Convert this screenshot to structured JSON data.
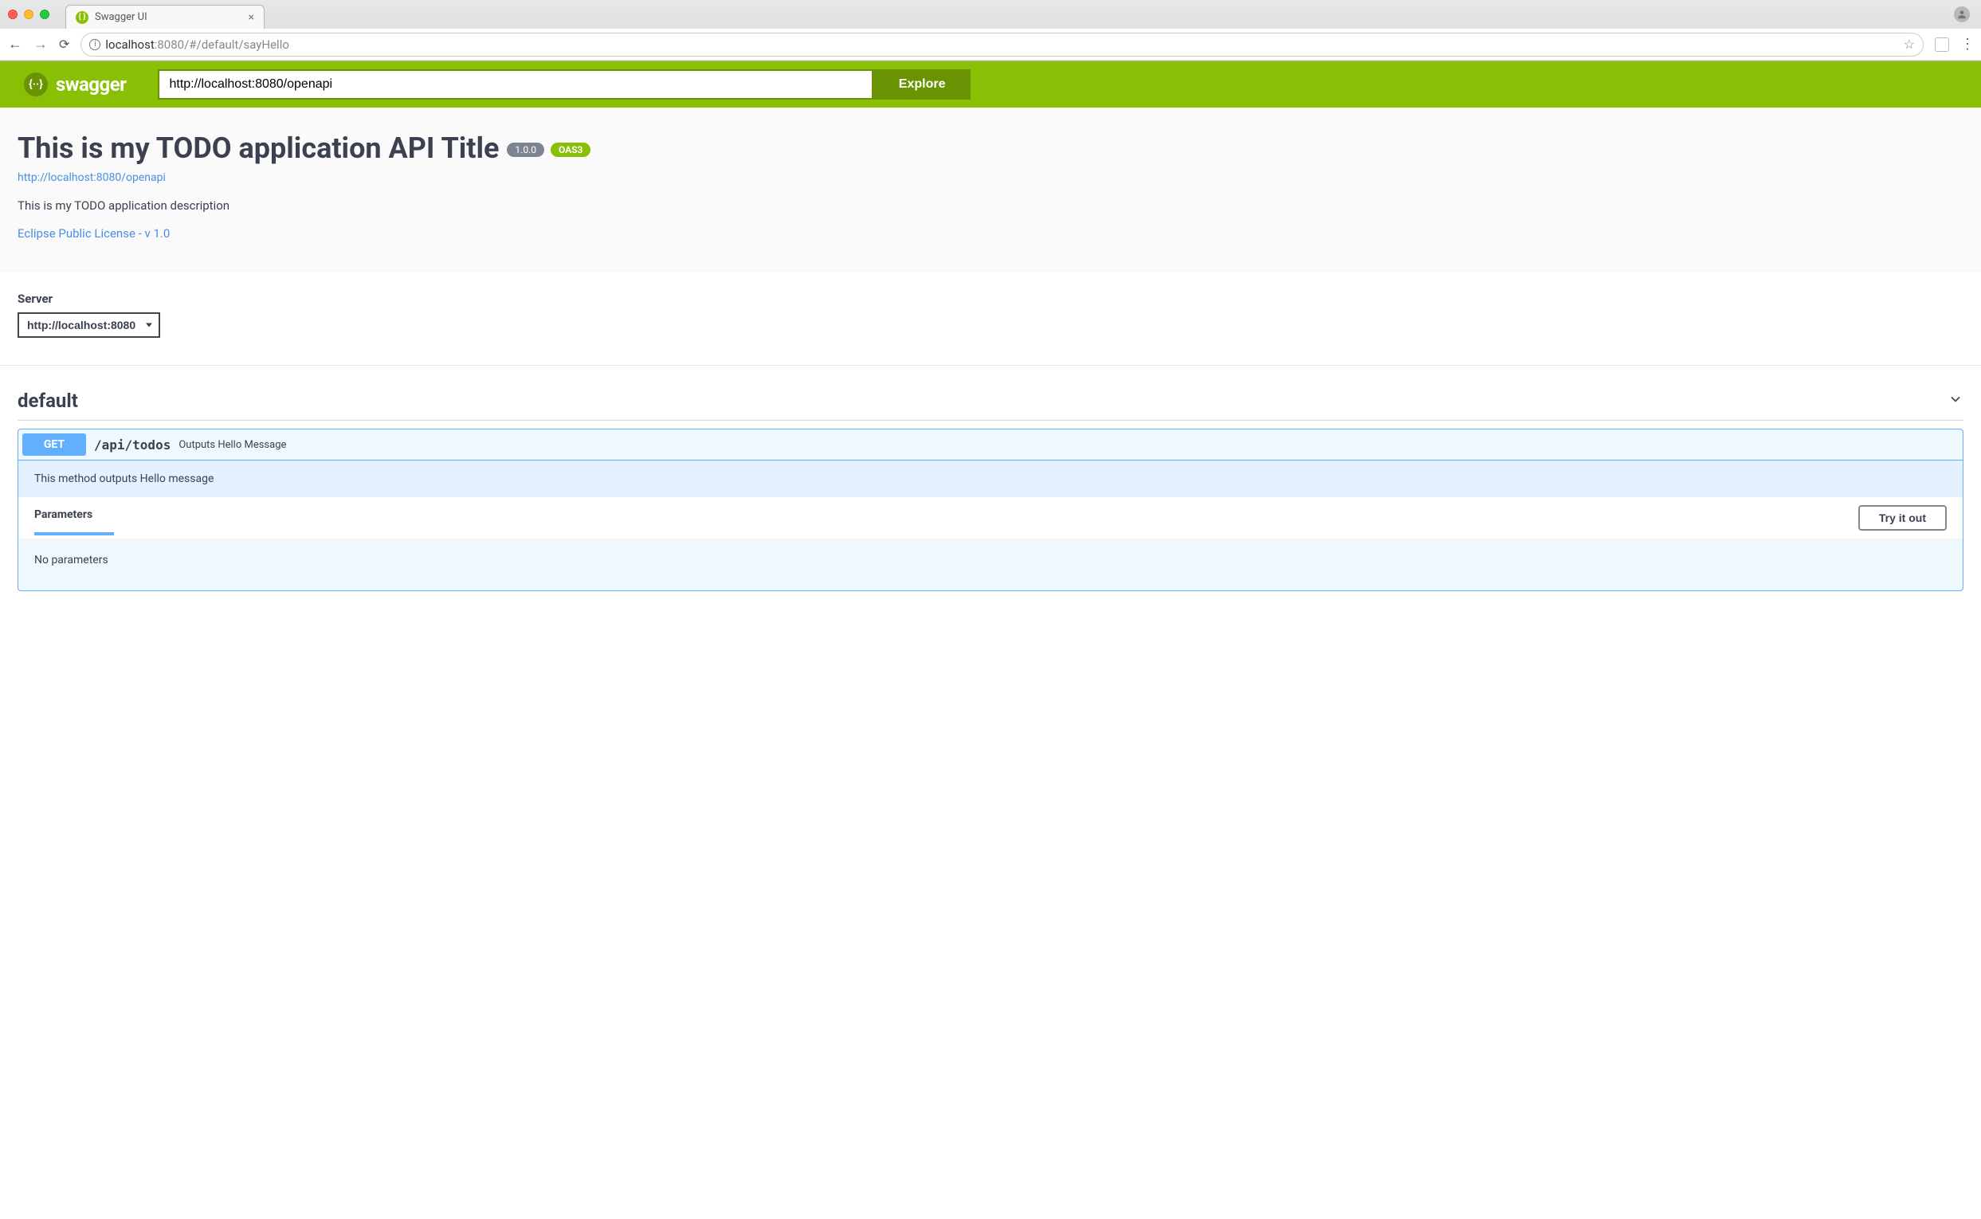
{
  "browser": {
    "tab_title": "Swagger UI",
    "url_host": "localhost",
    "url_port": ":8080",
    "url_path": "/#/default/sayHello"
  },
  "topbar": {
    "brand": "swagger",
    "input_value": "http://localhost:8080/openapi",
    "explore_label": "Explore"
  },
  "api": {
    "title": "This is my TODO application API Title",
    "version": "1.0.0",
    "oas_badge": "OAS3",
    "base_url": "http://localhost:8080/openapi",
    "description": "This is my TODO application description",
    "license_text": "Eclipse Public License - v 1.0"
  },
  "server": {
    "label": "Server",
    "selected": "http://localhost:8080"
  },
  "tag": {
    "name": "default"
  },
  "operation": {
    "method": "GET",
    "path": "/api/todos",
    "summary": "Outputs Hello Message",
    "description": "This method outputs Hello message",
    "params_title": "Parameters",
    "try_label": "Try it out",
    "no_params": "No parameters"
  }
}
